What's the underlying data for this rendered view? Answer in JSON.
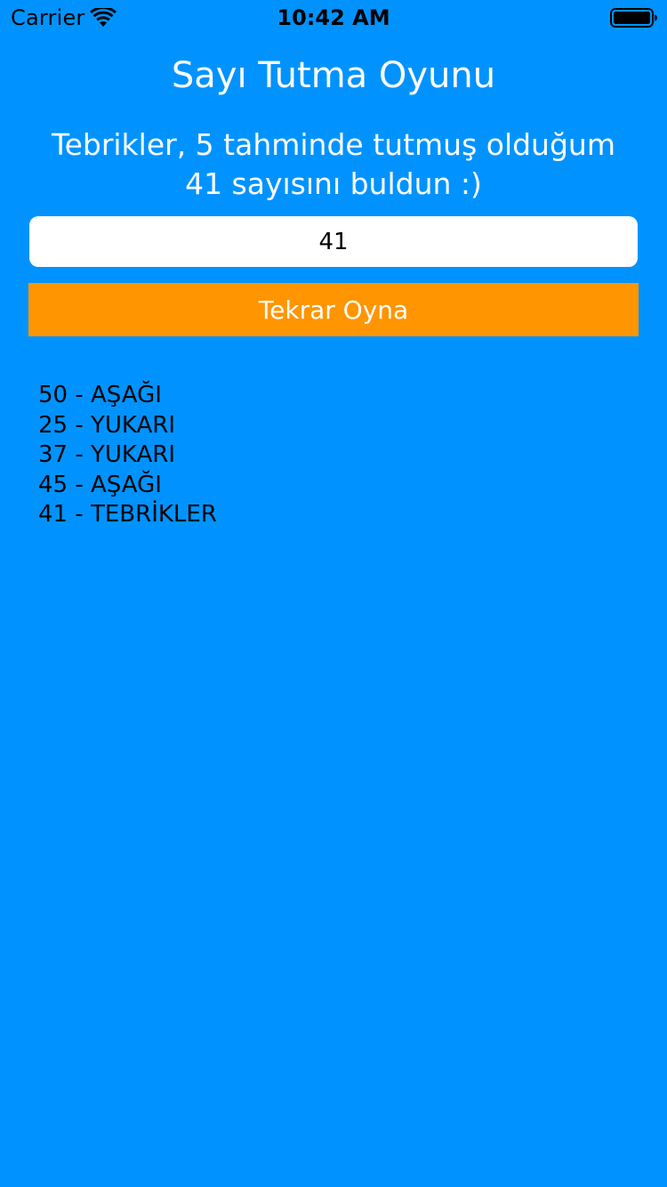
{
  "colors": {
    "background": "#0093FF",
    "button": "#FF9500",
    "input_background": "#FFFFFF",
    "title_text": "#FFFFFF",
    "history_text": "#000000"
  },
  "status_bar": {
    "carrier": "Carrier",
    "time": "10:42 AM",
    "icons": [
      "wifi-icon",
      "battery-icon"
    ]
  },
  "title": "Sayı Tutma Oyunu",
  "message": "Tebrikler, 5 tahminde tutmuş olduğum 41 sayısını buldun :)",
  "guess_input": {
    "value": "41"
  },
  "play_again_button": {
    "label": "Tekrar Oyna"
  },
  "history": [
    "50 - AŞAĞI",
    "25 - YUKARI",
    "37 - YUKARI",
    "45 - AŞAĞI",
    "41 - TEBRİKLER"
  ]
}
